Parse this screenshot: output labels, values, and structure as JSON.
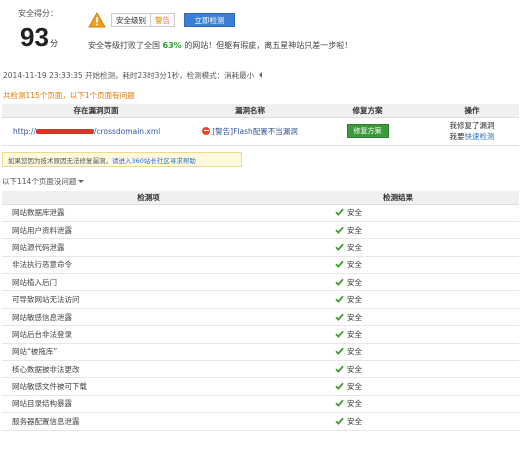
{
  "header": {
    "score_label": "安全得分：",
    "score": "93",
    "score_unit": "分",
    "level_label": "安全级别",
    "level_value": "警告",
    "detect_button": "立即检测",
    "summary_prefix": "安全等级打败了全国 ",
    "summary_pct": "63%",
    "summary_suffix": " 的网站！但躯有瑕疵，离五星神站只差一步啦！"
  },
  "status_line": "2014-11-19 23:33:35 开始检测，耗时23时3分1秒，检测模式：消耗最小",
  "problem_title": "共检测115个页面，以下1个页面有问题",
  "vuln_table": {
    "headers": [
      "存在漏洞页面",
      "漏洞名称",
      "修复方案",
      "操作"
    ],
    "rows": [
      {
        "url_prefix": "http://",
        "url_suffix": "/crossdomain.xml",
        "vuln_name": "[警告]Flash配置不当漏洞",
        "fix_button": "修复方案",
        "op_line1": "我修复了漏洞",
        "op_line2_prefix": "我要",
        "op_line2_link": "快速检测"
      }
    ]
  },
  "notice": {
    "text": "如果您因为技术原因无法修复漏洞，",
    "link": "请进入360站长社区寻求帮助"
  },
  "ok_count": "以下114个页面没问题",
  "check_table": {
    "headers": [
      "检测项",
      "检测结果"
    ],
    "rows": [
      {
        "item": "网站数据库泄露",
        "result": "安全"
      },
      {
        "item": "网站用户资料泄露",
        "result": "安全"
      },
      {
        "item": "网站源代码泄露",
        "result": "安全"
      },
      {
        "item": "非法执行恶意命令",
        "result": "安全"
      },
      {
        "item": "网站植入后门",
        "result": "安全"
      },
      {
        "item": "可导致网站无法访问",
        "result": "安全"
      },
      {
        "item": "网站敏感信息泄露",
        "result": "安全"
      },
      {
        "item": "网站后台非法登录",
        "result": "安全"
      },
      {
        "item": "网站“被拖库”",
        "result": "安全"
      },
      {
        "item": "核心数据被非法更改",
        "result": "安全"
      },
      {
        "item": "网站敏感文件被可下载",
        "result": "安全"
      },
      {
        "item": "网站目录结构暴露",
        "result": "安全"
      },
      {
        "item": "服务器配置信息泄露",
        "result": "安全"
      }
    ]
  },
  "colors": {
    "accent": "#3b7fd4",
    "warning": "#e08a00",
    "safe_green": "#2a9d2a",
    "danger_red": "#e04a2a"
  },
  "icons": {
    "warning": "warning-triangle-icon",
    "ban": "no-entry-icon",
    "check": "check-icon",
    "caret": "caret-down-icon"
  }
}
